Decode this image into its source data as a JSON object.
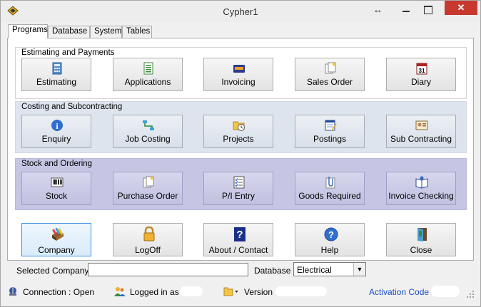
{
  "window": {
    "title": "Cypher1",
    "close_glyph": "✕"
  },
  "tabs": [
    {
      "label": "Programs"
    },
    {
      "label": "Database"
    },
    {
      "label": "System"
    },
    {
      "label": "Tables"
    }
  ],
  "groups": [
    {
      "title": "Estimating and Payments",
      "buttons": [
        {
          "label": "Estimating",
          "icon": "calculator-icon"
        },
        {
          "label": "Applications",
          "icon": "spreadsheet-icon"
        },
        {
          "label": "Invoicing",
          "icon": "credit-card-icon"
        },
        {
          "label": "Sales Order",
          "icon": "documents-icon"
        },
        {
          "label": "Diary",
          "icon": "calendar-icon"
        }
      ]
    },
    {
      "title": "Costing and Subcontracting",
      "buttons": [
        {
          "label": "Enquiry",
          "icon": "info-icon"
        },
        {
          "label": "Job Costing",
          "icon": "workflow-icon"
        },
        {
          "label": "Projects",
          "icon": "folder-clock-icon"
        },
        {
          "label": "Postings",
          "icon": "ledger-pencil-icon"
        },
        {
          "label": "Sub Contracting",
          "icon": "id-card-icon"
        }
      ]
    },
    {
      "title": "Stock and Ordering",
      "buttons": [
        {
          "label": "Stock",
          "icon": "barcode-icon"
        },
        {
          "label": "Purchase Order",
          "icon": "documents-icon"
        },
        {
          "label": "P/I Entry",
          "icon": "checklist-icon"
        },
        {
          "label": "Goods Required",
          "icon": "paperclip-icon"
        },
        {
          "label": "Invoice Checking",
          "icon": "open-book-icon"
        }
      ]
    }
  ],
  "bottom_buttons": [
    {
      "label": "Company",
      "icon": "card-file-icon"
    },
    {
      "label": "LogOff",
      "icon": "padlock-icon"
    },
    {
      "label": "About / Contact",
      "icon": "question-book-icon"
    },
    {
      "label": "Help",
      "icon": "help-icon"
    },
    {
      "label": "Close",
      "icon": "door-exit-icon"
    }
  ],
  "selected_company": {
    "label": "Selected Company",
    "value": ""
  },
  "database": {
    "label": "Database",
    "value": "Electrical"
  },
  "status": {
    "connection": "Connection : Open",
    "logged_in": "Logged in as",
    "version": "Version",
    "activation": "Activation Code"
  },
  "colors": {
    "group2_bg": "#dde4ee",
    "group3_bg": "#c6c6e4",
    "close_red": "#c7382f",
    "activation_link": "#1a4fc7"
  }
}
